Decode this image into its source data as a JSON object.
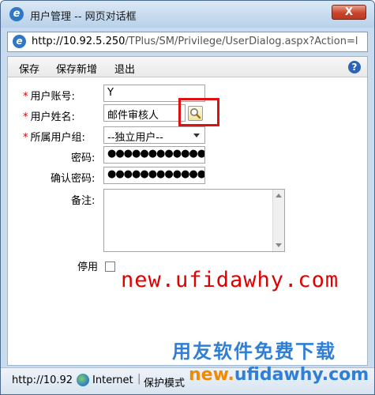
{
  "window": {
    "title": "用户管理 -- 网页对话框",
    "close_label": "X",
    "title_icon": "ie-icon"
  },
  "address": {
    "host": "http://10.92.5.250",
    "path": "/TPlus/SM/Privilege/UserDialog.aspx?Action=l"
  },
  "toolbar": {
    "save": "保存",
    "save_new": "保存新增",
    "exit": "退出",
    "help": "?"
  },
  "form": {
    "account_label": "用户账号:",
    "account_value": "Y",
    "name_label": "用户姓名:",
    "name_value": "邮件审核人",
    "group_label": "所属用户组:",
    "group_value": "--独立用户--",
    "password_label": "密码:",
    "password_value": "●●●●●●●●●●●●●●●●●●●●",
    "confirm_label": "确认密码:",
    "confirm_value": "●●●●●●●●●●●●●●●●●●●●",
    "remark_label": "备注:",
    "disable_label": "停用",
    "required_mark": "*"
  },
  "watermark": {
    "site": "new.ufidawhy.com",
    "slogan": "用友软件免费下载",
    "site_prefix": "new.",
    "site_rest": "ufidawhy.com"
  },
  "status": {
    "url": "http://10.92",
    "zone": "Internet",
    "separator": "|",
    "mode": "保护模式"
  },
  "colors": {
    "highlight": "#e01010",
    "watermark_red": "#e00000",
    "watermark_blue": "#2f7fd6"
  }
}
